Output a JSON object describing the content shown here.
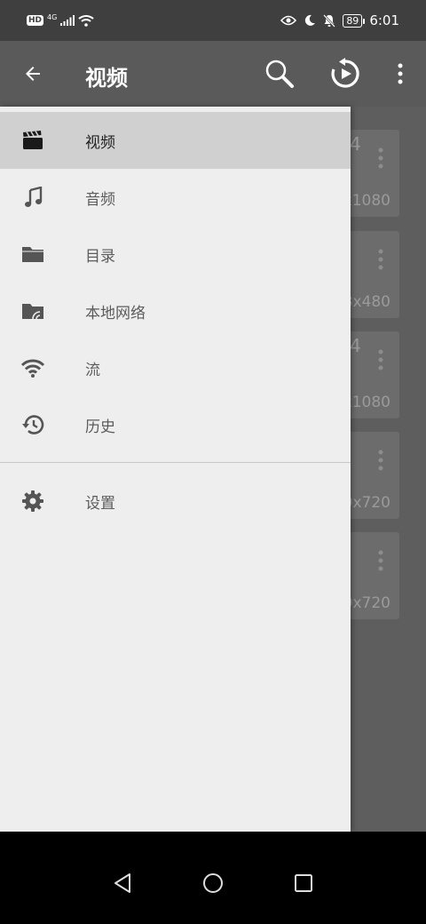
{
  "status": {
    "hd": "HD",
    "network": "4G",
    "battery": "89",
    "time": "6:01"
  },
  "appbar": {
    "title": "视频"
  },
  "background_cards": [
    {
      "top_text": "4",
      "resolution": "x1080"
    },
    {
      "top_text": "",
      "resolution": "8x480"
    },
    {
      "top_text": "4",
      "resolution": "x1080"
    },
    {
      "top_text": "",
      "resolution": "0x720"
    },
    {
      "top_text": "",
      "resolution": "0x720"
    }
  ],
  "drawer": {
    "items": [
      {
        "label": "视频",
        "icon": "clapperboard-icon",
        "active": true
      },
      {
        "label": "音频",
        "icon": "music-note-icon",
        "active": false
      },
      {
        "label": "目录",
        "icon": "folder-icon",
        "active": false
      },
      {
        "label": "本地网络",
        "icon": "network-folder-icon",
        "active": false
      },
      {
        "label": "流",
        "icon": "wifi-stream-icon",
        "active": false
      },
      {
        "label": "历史",
        "icon": "history-icon",
        "active": false
      }
    ],
    "settings_label": "设置"
  },
  "colors": {
    "appbar": "#5a5a5a",
    "drawer": "#eeeeee",
    "active_item": "#d0d0d0",
    "icon": "#555555"
  }
}
